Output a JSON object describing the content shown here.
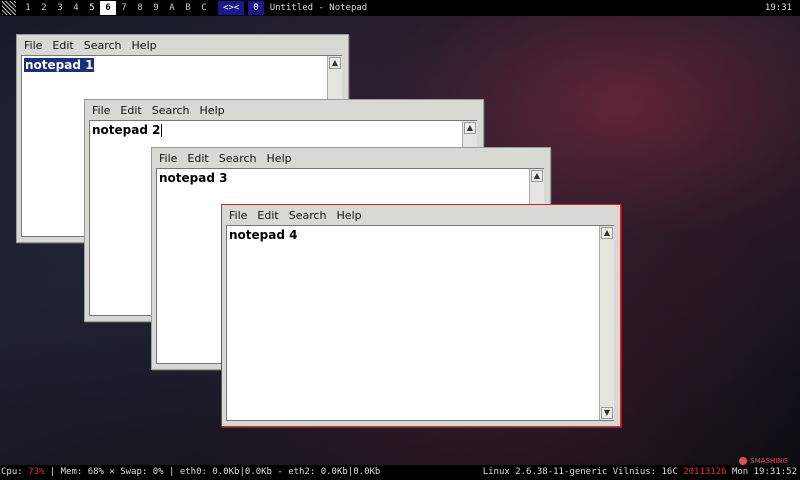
{
  "topbar": {
    "workspaces": [
      "1",
      "2",
      "3",
      "4",
      "5",
      "6",
      "7",
      "8",
      "9",
      "A",
      "B",
      "C"
    ],
    "layout_symbol": "<><",
    "tag_count": "0",
    "window_title": "Untitled - Notepad",
    "clock": "19:31"
  },
  "menu": {
    "file": "File",
    "edit": "Edit",
    "search": "Search",
    "help": "Help"
  },
  "windows": [
    {
      "text": "notepad 1"
    },
    {
      "text": "notepad 2"
    },
    {
      "text": "notepad 3"
    },
    {
      "text": "notepad 4"
    }
  ],
  "statusbar": {
    "cpu_label": "Cpu:",
    "cpu_value": "73%",
    "rest_left": " | Mem: 68% × Swap: 0% | eth0: 0.0Kb|0.0Kb - eth2: 0.0Kb|0.0Kb",
    "sys_info": "Linux 2.6.38-11-generic Vilnius: 16C ",
    "date": "20113126",
    "time": " Mon 19:31:52"
  },
  "watermark": "SMASHING",
  "colors": {
    "active_border": "#d42424",
    "selection": "#1b2f7a",
    "tag_bg": "#1a1a8a"
  }
}
